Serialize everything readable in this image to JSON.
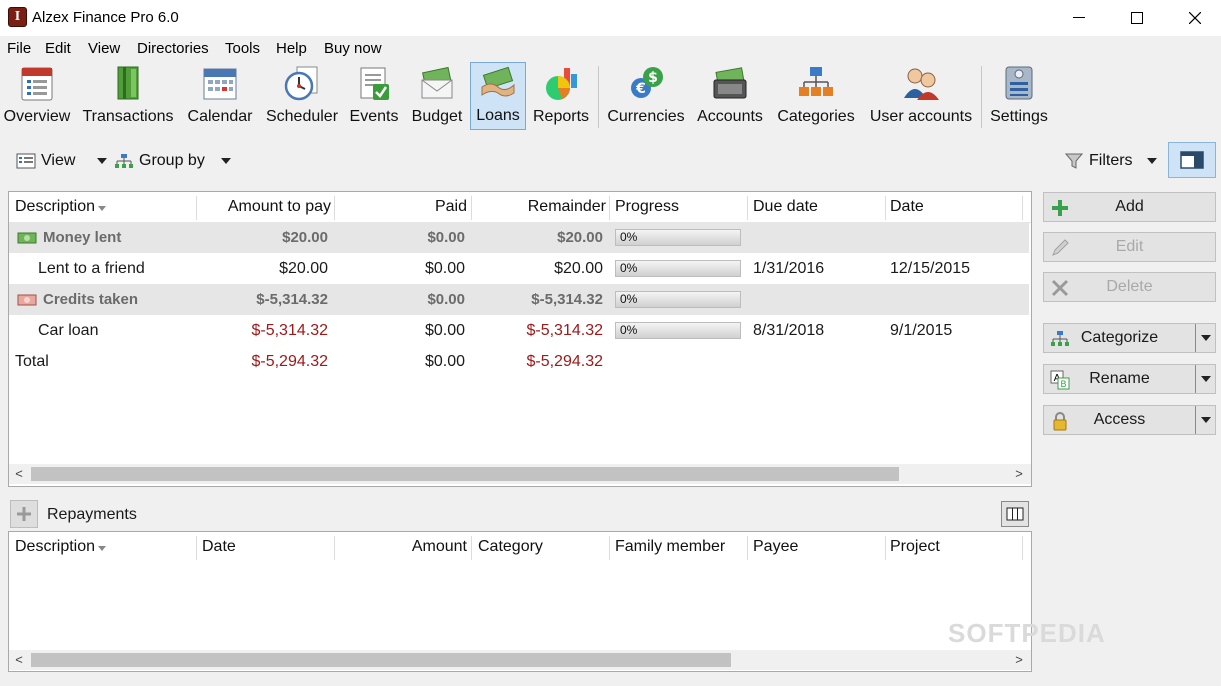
{
  "window": {
    "title": "Alzex Finance Pro 6.0"
  },
  "menu": [
    "File",
    "Edit",
    "View",
    "Directories",
    "Tools",
    "Help",
    "Buy now"
  ],
  "toolbar": [
    {
      "label": "Overview",
      "icon": "calendar-list-icon"
    },
    {
      "label": "Transactions",
      "icon": "book-icon"
    },
    {
      "label": "Calendar",
      "icon": "calendar-icon"
    },
    {
      "label": "Scheduler",
      "icon": "clock-icon"
    },
    {
      "label": "Events",
      "icon": "checklist-icon"
    },
    {
      "label": "Budget",
      "icon": "money-envelope-icon"
    },
    {
      "label": "Loans",
      "icon": "handshake-money-icon",
      "active": true
    },
    {
      "label": "Reports",
      "icon": "pie-chart-icon"
    },
    {
      "label": "Currencies",
      "icon": "currency-icon"
    },
    {
      "label": "Accounts",
      "icon": "cash-icon"
    },
    {
      "label": "Categories",
      "icon": "hierarchy-icon"
    },
    {
      "label": "User accounts",
      "icon": "users-icon"
    },
    {
      "label": "Settings",
      "icon": "settings-icon"
    }
  ],
  "subbar": {
    "view": "View",
    "group_by": "Group by",
    "filters": "Filters"
  },
  "loans": {
    "columns": [
      "Description",
      "Amount to pay",
      "Paid",
      "Remainder",
      "Progress",
      "Due date",
      "Date"
    ],
    "groups": [
      {
        "name": "Money lent",
        "amount": "$20.00",
        "paid": "$0.00",
        "remainder": "$20.00",
        "progress": "0%",
        "items": [
          {
            "description": "Lent to a friend",
            "amount": "$20.00",
            "paid": "$0.00",
            "remainder": "$20.00",
            "progress": "0%",
            "due_date": "1/31/2016",
            "date": "12/15/2015"
          }
        ]
      },
      {
        "name": "Credits taken",
        "amount": "$-5,314.32",
        "paid": "$0.00",
        "remainder": "$-5,314.32",
        "progress": "0%",
        "items": [
          {
            "description": "Car loan",
            "amount": "$-5,314.32",
            "paid": "$0.00",
            "remainder": "$-5,314.32",
            "progress": "0%",
            "due_date": "8/31/2018",
            "date": "9/1/2015"
          }
        ]
      }
    ],
    "total": {
      "label": "Total",
      "amount": "$-5,294.32",
      "paid": "$0.00",
      "remainder": "$-5,294.32"
    }
  },
  "actions": {
    "add": "Add",
    "edit": "Edit",
    "delete": "Delete",
    "categorize": "Categorize",
    "rename": "Rename",
    "access": "Access"
  },
  "repayments": {
    "title": "Repayments",
    "columns": [
      "Description",
      "Date",
      "Amount",
      "Category",
      "Family member",
      "Payee",
      "Project"
    ]
  },
  "watermark": "SOFTPEDIA",
  "colors": {
    "negative": "#a01818",
    "group_text": "#6b6b6b",
    "active_tab": "#cfe3f7"
  }
}
